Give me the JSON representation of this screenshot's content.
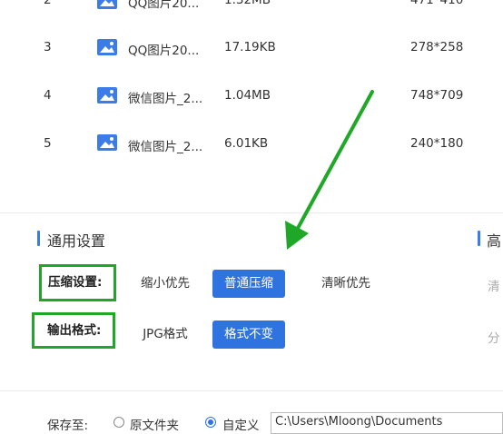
{
  "file_table": {
    "rows": [
      {
        "index": "2",
        "name": "QQ图片20...",
        "size": "1.32MB",
        "dimensions": "471*410"
      },
      {
        "index": "3",
        "name": "QQ图片20...",
        "size": "17.19KB",
        "dimensions": "278*258"
      },
      {
        "index": "4",
        "name": "微信图片_2...",
        "size": "1.04MB",
        "dimensions": "748*709"
      },
      {
        "index": "5",
        "name": "微信图片_2...",
        "size": "6.01KB",
        "dimensions": "240*180"
      }
    ]
  },
  "general_settings": {
    "title": "通用设置",
    "compression": {
      "label": "压缩设置:",
      "options": [
        "缩小优先",
        "普通压缩",
        "清晰优先"
      ],
      "selected": "普通压缩"
    },
    "output_format": {
      "label": "输出格式:",
      "options": [
        "JPG格式",
        "格式不变"
      ],
      "selected": "格式不变"
    }
  },
  "advanced_settings": {
    "title_partial": "高",
    "option1_partial": "清",
    "option2_partial": "分"
  },
  "save_to": {
    "label": "保存至:",
    "option_original": "原文件夹",
    "option_custom": "自定义",
    "selected": "自定义",
    "path": "C:\\Users\\Mloong\\Documents"
  },
  "colors": {
    "accent": "#2f73e0",
    "annotation_green": "#1fa827"
  }
}
